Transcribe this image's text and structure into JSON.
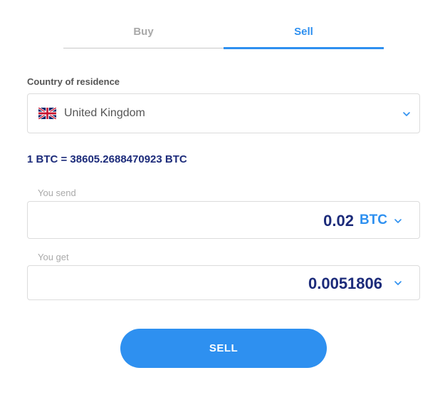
{
  "tabs": [
    {
      "label": "Buy",
      "active": false
    },
    {
      "label": "Sell",
      "active": true
    }
  ],
  "country": {
    "label": "Country of residence",
    "selected": "United Kingdom",
    "flag_icon": "uk-flag-icon"
  },
  "rate": "1 BTC = 38605.2688470923 BTC",
  "send": {
    "label": "You send",
    "value": "0.02",
    "currency": "BTC"
  },
  "get": {
    "label": "You get",
    "value": "0.0051806",
    "currency": ""
  },
  "action": {
    "label": "SELL"
  },
  "colors": {
    "accent": "#2e90f0",
    "amount_text": "#1c2b7a",
    "inactive_tab": "#a9a9a9"
  }
}
